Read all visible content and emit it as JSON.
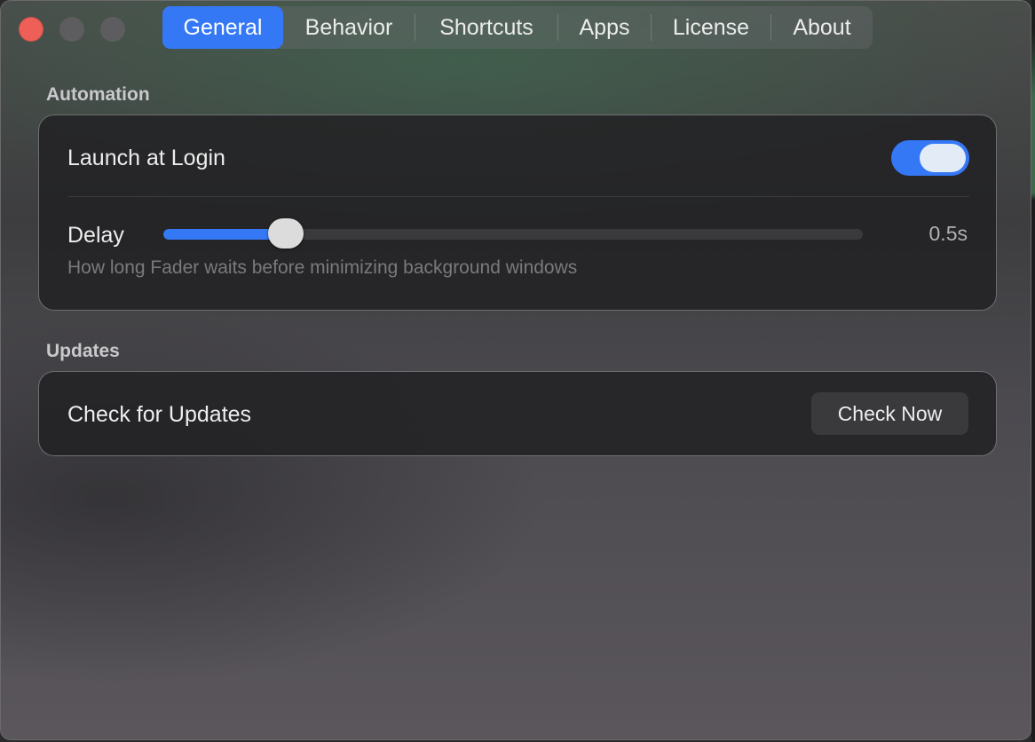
{
  "window": {
    "traffic_lights": [
      {
        "name": "close",
        "color": "#ed5f57"
      },
      {
        "name": "minimize",
        "color": "#5d5d60"
      },
      {
        "name": "zoom",
        "color": "#5d5d60"
      }
    ]
  },
  "tabs": [
    {
      "label": "General",
      "active": true
    },
    {
      "label": "Behavior",
      "active": false
    },
    {
      "label": "Shortcuts",
      "active": false
    },
    {
      "label": "Apps",
      "active": false
    },
    {
      "label": "License",
      "active": false
    },
    {
      "label": "About",
      "active": false
    }
  ],
  "automation": {
    "title": "Automation",
    "launch_at_login": {
      "label": "Launch at Login",
      "enabled": true
    },
    "delay": {
      "label": "Delay",
      "value_text": "0.5s",
      "level": 0.175,
      "hint": "How long Fader waits before minimizing background windows"
    }
  },
  "updates": {
    "title": "Updates",
    "check": {
      "label": "Check for Updates",
      "button_label": "Check Now"
    }
  },
  "colors": {
    "accent": "#3478f6",
    "close": "#ed5f57"
  }
}
